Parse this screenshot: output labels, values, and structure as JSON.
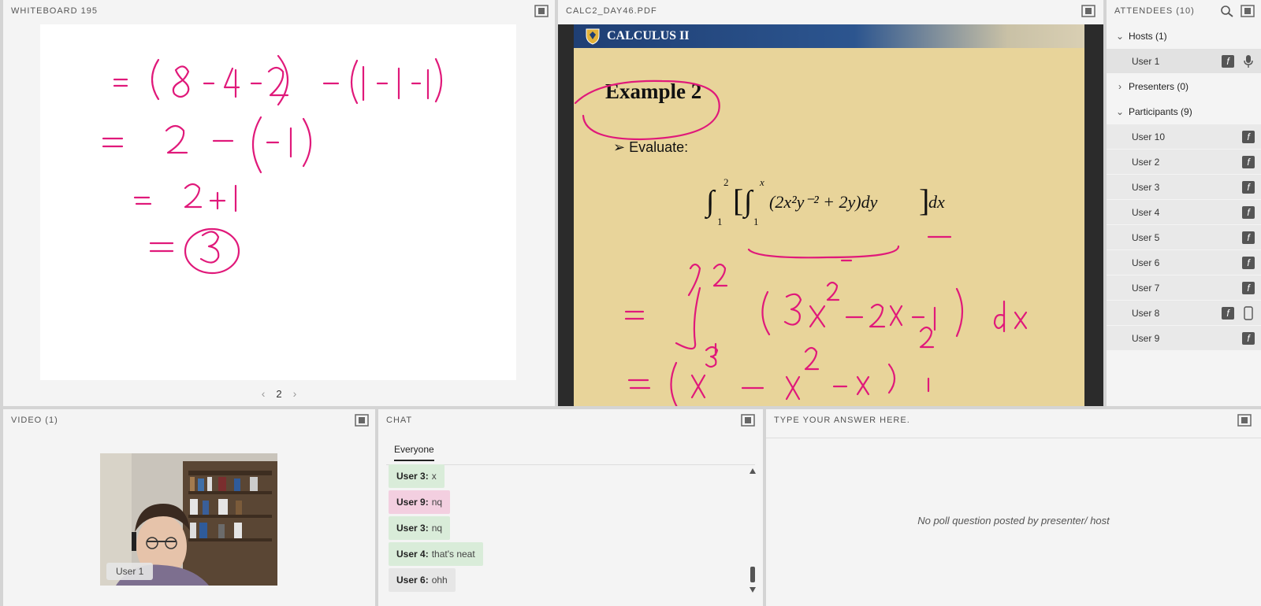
{
  "whiteboard": {
    "title": "WHITEBOARD 195",
    "page": "2"
  },
  "pdf": {
    "title": "CALC2_DAY46.PDF",
    "banner_title": "CALCULUS II",
    "example_title": "Example 2",
    "evaluate_label": "➢ Evaluate:"
  },
  "attendees": {
    "title": "ATTENDEES  (10)",
    "hosts_label": "Hosts (1)",
    "presenters_label": "Presenters (0)",
    "participants_label": "Participants (9)",
    "hosts": [
      "User 1"
    ],
    "participants": [
      "User 10",
      "User 2",
      "User 3",
      "User 4",
      "User 5",
      "User 6",
      "User 7",
      "User 8",
      "User 9"
    ]
  },
  "video": {
    "title": "VIDEO  (1)",
    "user_label": "User 1"
  },
  "chat": {
    "title": "CHAT",
    "tab": "Everyone",
    "messages": [
      {
        "user": "User 3:",
        "text": "x",
        "color": "#d9ecd9"
      },
      {
        "user": "User 9:",
        "text": "nq",
        "color": "#f3cfe0"
      },
      {
        "user": "User 3:",
        "text": "nq",
        "color": "#d9ecd9"
      },
      {
        "user": "User 4:",
        "text": "that's neat",
        "color": "#d9ecd9"
      },
      {
        "user": "User 6:",
        "text": "ohh",
        "color": "#e6e6e6"
      }
    ]
  },
  "poll": {
    "title": "TYPE YOUR ANSWER HERE.",
    "empty_message": "No poll question posted by presenter/ host"
  },
  "colors": {
    "ink": "#e0197a",
    "accent_bg": "#f4f4f4"
  }
}
